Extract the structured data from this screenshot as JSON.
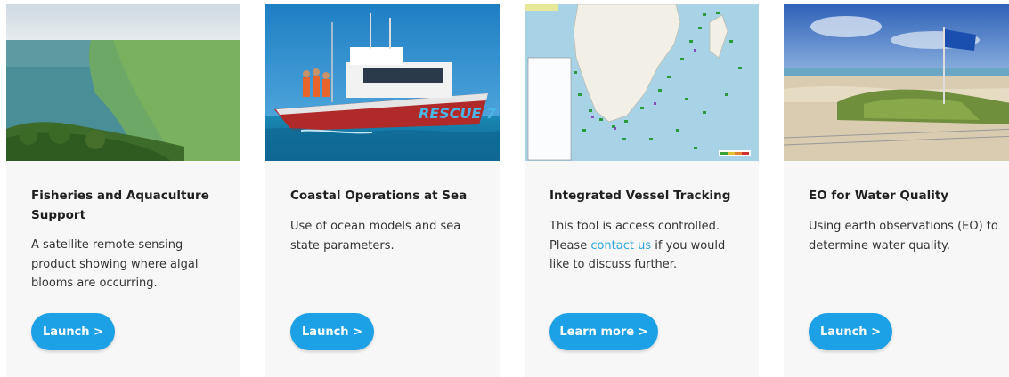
{
  "cards": [
    {
      "title": "Fisheries and Aquaculture Support",
      "description": "A satellite remote-sensing product showing where algal blooms are occurring.",
      "button_label": "Launch >"
    },
    {
      "title": "Coastal Operations at Sea",
      "description": "Use of ocean models and sea state parameters.",
      "button_label": "Launch >",
      "boat_label": "RESCUE 7"
    },
    {
      "title": "Integrated Vessel Tracking",
      "description_before": "This tool is access controlled. Please ",
      "link_text": "contact us",
      "description_after": " if you would like to discuss further.",
      "button_label": "Learn more >"
    },
    {
      "title": "EO for Water Quality",
      "description": "Using earth observations (EO) to determine water quality.",
      "button_label": "Launch >"
    }
  ],
  "colors": {
    "button": "#1da1e6",
    "link": "#2aa5e0",
    "card_bg": "#f7f7f7"
  }
}
